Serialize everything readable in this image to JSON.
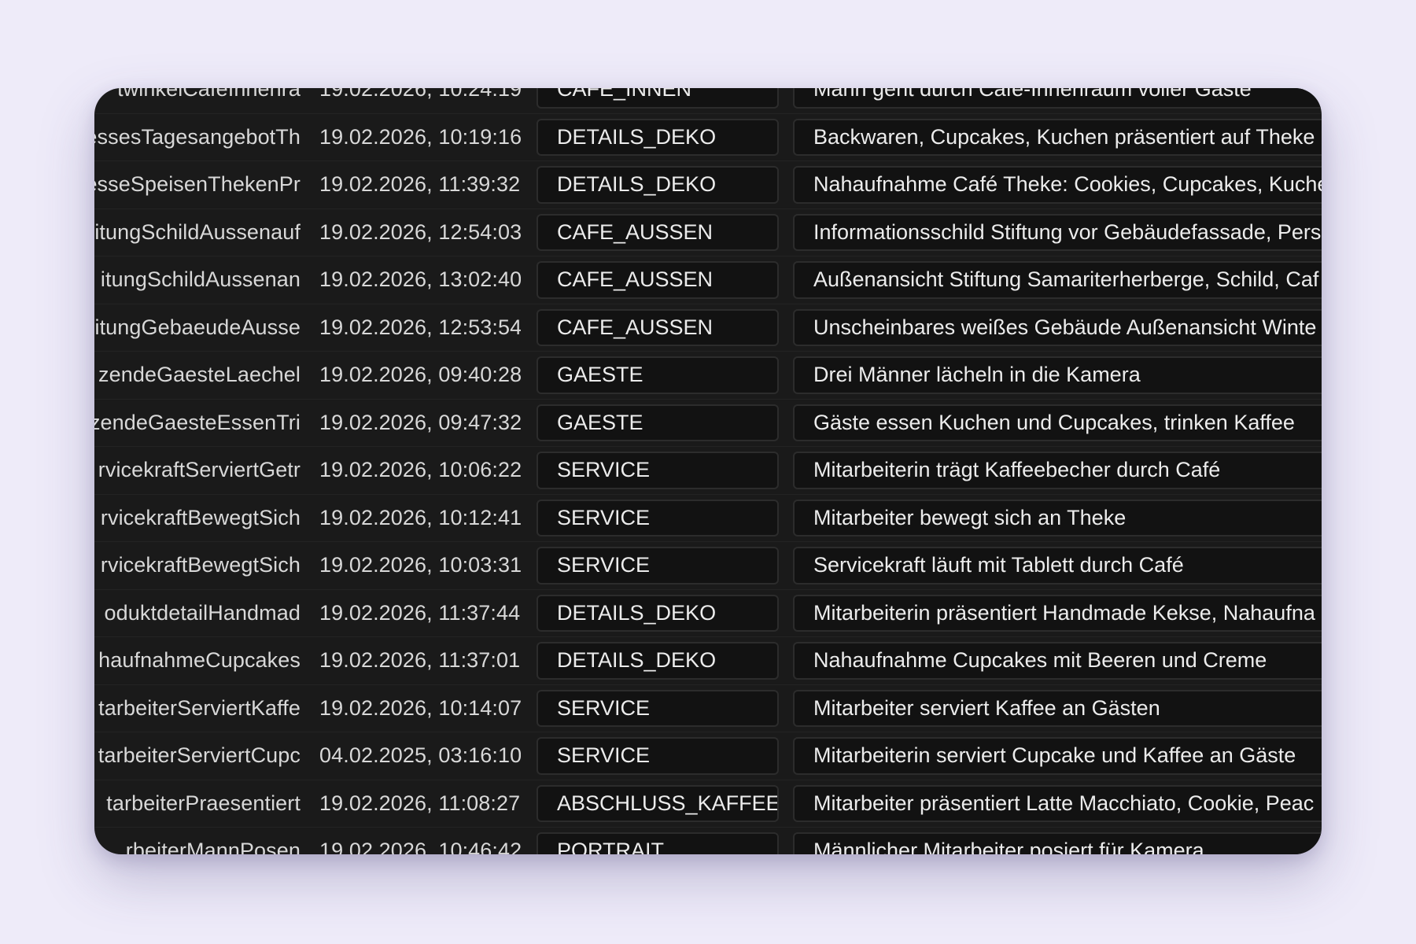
{
  "rows": [
    {
      "name": "twinkelCafeInnenra",
      "date": "19.02.2026, 10:24:19",
      "category": "CAFE_INNEN",
      "description": "Mann geht durch Café-Innenraum voller Gäste"
    },
    {
      "name": "essesTagesangebotTh",
      "date": "19.02.2026, 10:19:16",
      "category": "DETAILS_DEKO",
      "description": "Backwaren, Cupcakes, Kuchen präsentiert auf Theke"
    },
    {
      "name": "esseSpeisenThekenPr",
      "date": "19.02.2026, 11:39:32",
      "category": "DETAILS_DEKO",
      "description": "Nahaufnahme Café Theke: Cookies, Cupcakes, Kuche"
    },
    {
      "name": "itungSchildAussenauf",
      "date": "19.02.2026, 12:54:03",
      "category": "CAFE_AUSSEN",
      "description": "Informationsschild Stiftung vor Gebäudefassade, Pers"
    },
    {
      "name": "itungSchildAussenan",
      "date": "19.02.2026, 13:02:40",
      "category": "CAFE_AUSSEN",
      "description": "Außenansicht Stiftung Samariterherberge, Schild, Caf"
    },
    {
      "name": "itungGebaeudeAusse",
      "date": "19.02.2026, 12:53:54",
      "category": "CAFE_AUSSEN",
      "description": "Unscheinbares weißes Gebäude Außenansicht Winte"
    },
    {
      "name": "zendeGaesteLaechel",
      "date": "19.02.2026, 09:40:28",
      "category": "GAESTE",
      "description": "Drei Männer lächeln in die Kamera"
    },
    {
      "name": "zendeGaesteEssenTri",
      "date": "19.02.2026, 09:47:32",
      "category": "GAESTE",
      "description": "Gäste essen Kuchen und Cupcakes, trinken Kaffee"
    },
    {
      "name": "rvicekraftServiertGetr",
      "date": "19.02.2026, 10:06:22",
      "category": "SERVICE",
      "description": "Mitarbeiterin trägt Kaffeebecher durch Café"
    },
    {
      "name": "rvicekraftBewegtSich",
      "date": "19.02.2026, 10:12:41",
      "category": "SERVICE",
      "description": "Mitarbeiter bewegt sich an Theke"
    },
    {
      "name": "rvicekraftBewegtSich",
      "date": "19.02.2026, 10:03:31",
      "category": "SERVICE",
      "description": "Servicekraft läuft mit Tablett durch Café"
    },
    {
      "name": "oduktdetailHandmad",
      "date": "19.02.2026, 11:37:44",
      "category": "DETAILS_DEKO",
      "description": "Mitarbeiterin präsentiert Handmade Kekse, Nahaufna"
    },
    {
      "name": "haufnahmeCupcakes",
      "date": "19.02.2026, 11:37:01",
      "category": "DETAILS_DEKO",
      "description": "Nahaufnahme Cupcakes mit Beeren und Creme"
    },
    {
      "name": "tarbeiterServiertKaffe",
      "date": "19.02.2026, 10:14:07",
      "category": "SERVICE",
      "description": "Mitarbeiter serviert Kaffee an Gästen"
    },
    {
      "name": "tarbeiterServiertCupc",
      "date": "04.02.2025, 03:16:10",
      "category": "SERVICE",
      "description": "Mitarbeiterin serviert Cupcake und Kaffee an Gäste"
    },
    {
      "name": "tarbeiterPraesentiert",
      "date": "19.02.2026, 11:08:27",
      "category": "ABSCHLUSS_KAFFEE",
      "description": "Mitarbeiter präsentiert Latte Macchiato, Cookie, Peac"
    },
    {
      "name": "rbeiterMannPosen",
      "date": "19.02.2026, 10:46:42",
      "category": "PORTRAIT",
      "description": "Männlicher Mitarbeiter posiert für Kamera"
    }
  ]
}
